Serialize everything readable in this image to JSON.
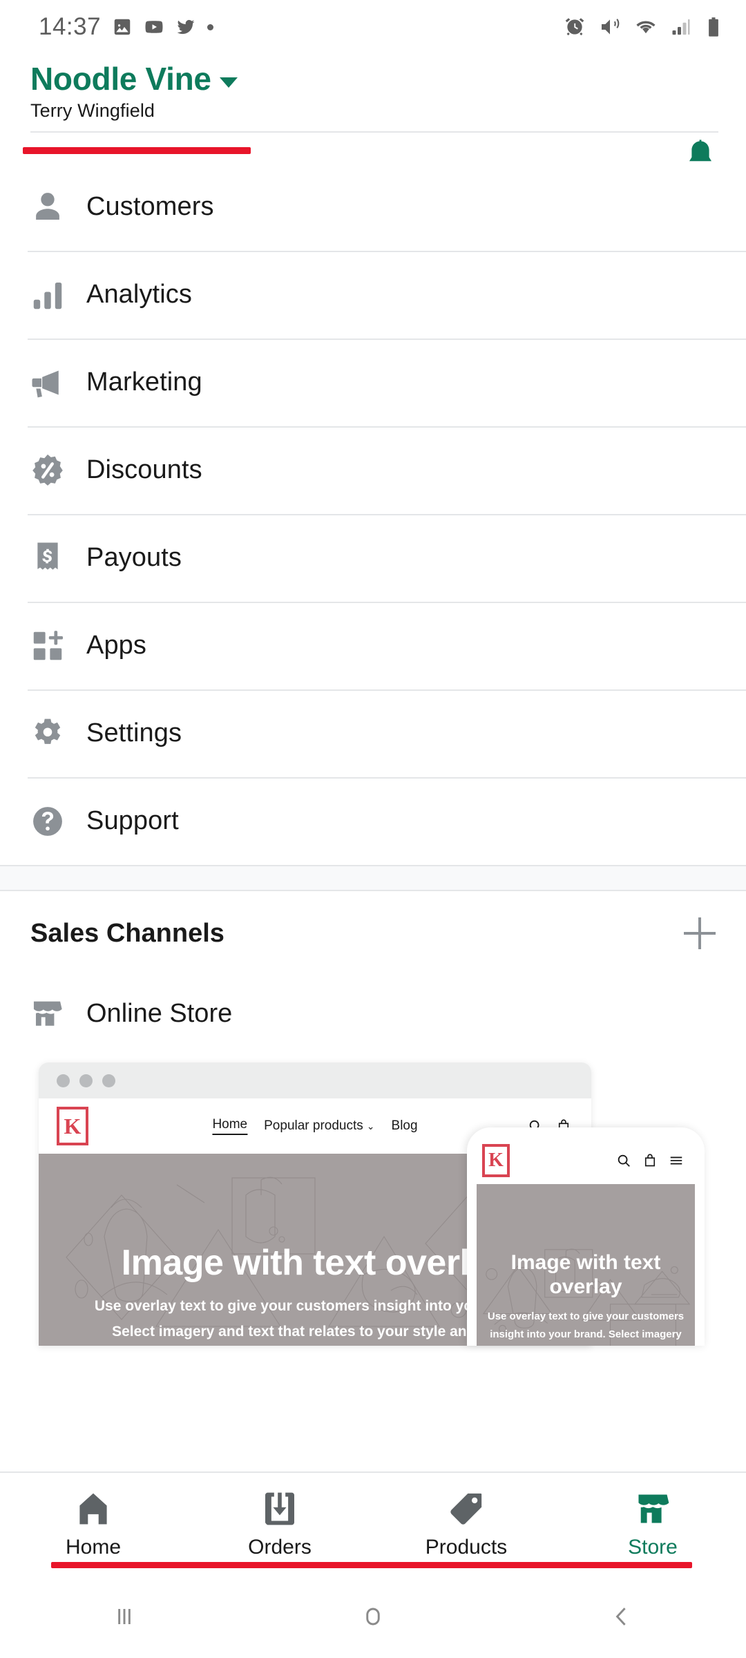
{
  "status_bar": {
    "time": "14:37",
    "left_icons": [
      "photo-gallery-icon",
      "youtube-icon",
      "twitter-icon",
      "more-dot-icon"
    ],
    "right_icons": [
      "alarm-icon",
      "vibrate-mute-icon",
      "wifi-icon",
      "cellular-signal-icon",
      "battery-icon"
    ]
  },
  "header": {
    "store_name": "Noodle Vine",
    "store_dropdown_icon": "chevron-down-icon",
    "user_name": "Terry Wingfield",
    "notification_icon": "bell-icon",
    "accent_color": "#0E7B5C",
    "highlight_color": "#E8152A"
  },
  "menu": {
    "items": [
      {
        "label": "Customers",
        "icon": "person-icon"
      },
      {
        "label": "Analytics",
        "icon": "bar-chart-icon"
      },
      {
        "label": "Marketing",
        "icon": "megaphone-icon"
      },
      {
        "label": "Discounts",
        "icon": "discount-percent-icon"
      },
      {
        "label": "Payouts",
        "icon": "receipt-dollar-icon"
      },
      {
        "label": "Apps",
        "icon": "apps-grid-plus-icon"
      },
      {
        "label": "Settings",
        "icon": "gear-icon"
      },
      {
        "label": "Support",
        "icon": "question-circle-icon"
      }
    ]
  },
  "sales_channels": {
    "title": "Sales Channels",
    "add_icon": "plus-icon",
    "items": [
      {
        "label": "Online Store",
        "icon": "storefront-icon"
      }
    ]
  },
  "store_preview": {
    "desktop": {
      "logo_letter": "K",
      "nav_links": [
        "Home",
        "Popular products",
        "Blog"
      ],
      "active_link": "Home",
      "dropdown_icon": "chevron-down-icon",
      "search_icon": "search-icon",
      "bag_icon": "shopping-bag-icon",
      "hero_heading": "Image with text overlay",
      "hero_line1": "Use overlay text to give your customers insight into your brand.",
      "hero_line2": "Select imagery and text that relates to your style and story."
    },
    "mobile": {
      "logo_letter": "K",
      "search_icon": "search-icon",
      "bag_icon": "shopping-bag-icon",
      "menu_icon": "hamburger-menu-icon",
      "hero_heading": "Image with text overlay",
      "hero_body": "Use overlay text to give your customers insight into your brand. Select imagery and text that relates to your style and story."
    }
  },
  "tab_bar": {
    "tabs": [
      {
        "label": "Home",
        "icon": "house-icon",
        "active": false
      },
      {
        "label": "Orders",
        "icon": "orders-inbox-icon",
        "active": false
      },
      {
        "label": "Products",
        "icon": "price-tag-icon",
        "active": false
      },
      {
        "label": "Store",
        "icon": "storefront-icon",
        "active": true
      }
    ]
  },
  "android_nav": {
    "buttons": [
      {
        "icon": "recent-apps-icon"
      },
      {
        "icon": "home-circle-icon"
      },
      {
        "icon": "back-chevron-icon"
      }
    ]
  }
}
